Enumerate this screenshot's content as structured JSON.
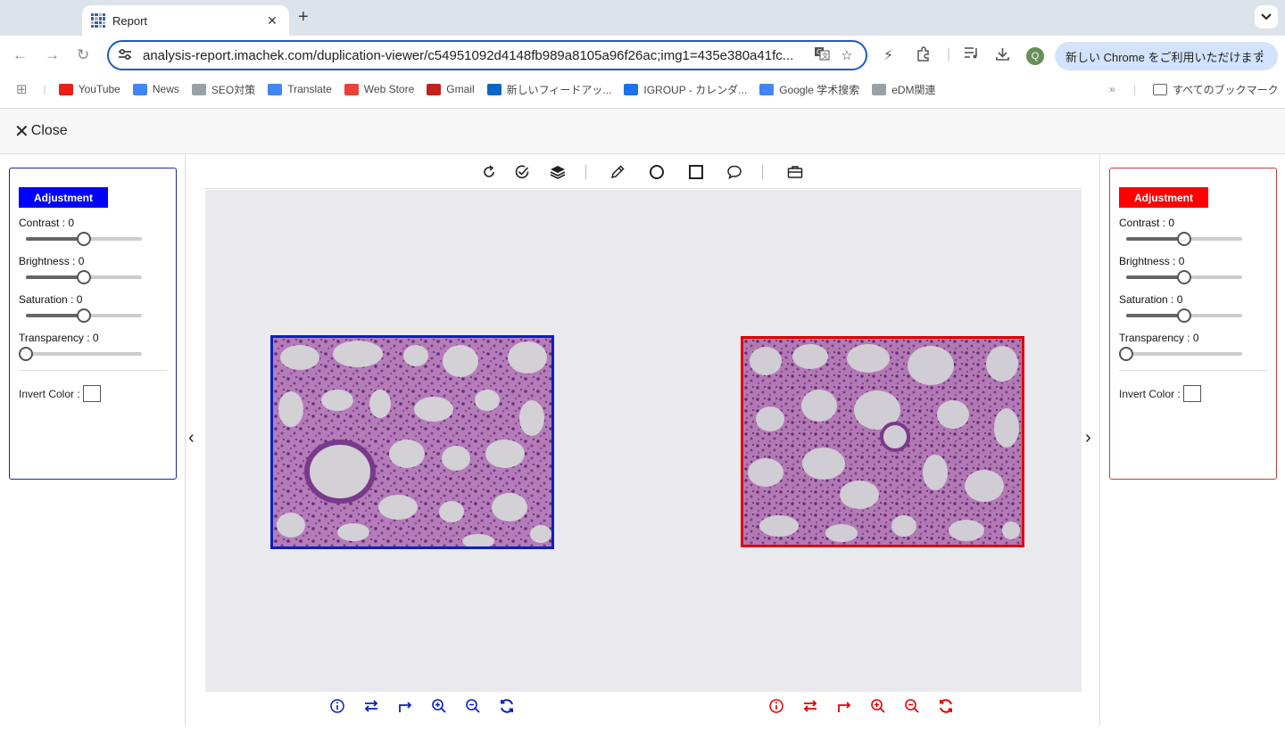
{
  "browser": {
    "tab_title": "Report",
    "url": "analysis-report.imachek.com/duplication-viewer/c54951092d4148fb989a8105a96f26ac;img1=435e380a41fc...",
    "promo_text": "新しい Chrome をご利用いただけます",
    "avatar_letter": "Q",
    "bookmarks": [
      {
        "label": "YouTube",
        "color": "#e62117"
      },
      {
        "label": "News",
        "color": "#4285f4"
      },
      {
        "label": "SEO対策",
        "color": "#9aa0a6"
      },
      {
        "label": "Translate",
        "color": "#4285f4"
      },
      {
        "label": "Web Store",
        "color": "#ea4335"
      },
      {
        "label": "Gmail",
        "color": "#c5221f"
      },
      {
        "label": "新しいフィードアッ...",
        "color": "#0a66c2"
      },
      {
        "label": "IGROUP - カレンダ...",
        "color": "#1a73e8"
      },
      {
        "label": "Google 学术搜索",
        "color": "#4285f4"
      },
      {
        "label": "eDM関連",
        "color": "#9aa0a6"
      }
    ],
    "all_bookmarks": "すべてのブックマーク"
  },
  "header": {
    "close_label": "Close"
  },
  "left_panel": {
    "accent": "#0000ff",
    "button": "Adjustment",
    "contrast": "Contrast : 0",
    "brightness": "Brightness : 0",
    "saturation": "Saturation : 0",
    "transparency": "Transparency : 0",
    "invert": "Invert Color :",
    "levels": {
      "contrast": 0.5,
      "brightness": 0.5,
      "saturation": 0.5,
      "transparency": 0
    }
  },
  "right_panel": {
    "accent": "#ff0000",
    "button": "Adjustment",
    "contrast": "Contrast : 0",
    "brightness": "Brightness : 0",
    "saturation": "Saturation : 0",
    "transparency": "Transparency : 0",
    "invert": "Invert Color :",
    "levels": {
      "contrast": 0.5,
      "brightness": 0.5,
      "saturation": 0.5,
      "transparency": 0
    }
  },
  "toolbar_icons": [
    "rotate-icon",
    "check-circle-icon",
    "layers-icon",
    "pencil-icon",
    "circle-icon",
    "square-icon",
    "comment-icon",
    "briefcase-icon"
  ],
  "image_controls": [
    "info-icon",
    "swap-icon",
    "redo-arrow-icon",
    "zoom-in-icon",
    "zoom-out-icon",
    "refresh-icon"
  ]
}
